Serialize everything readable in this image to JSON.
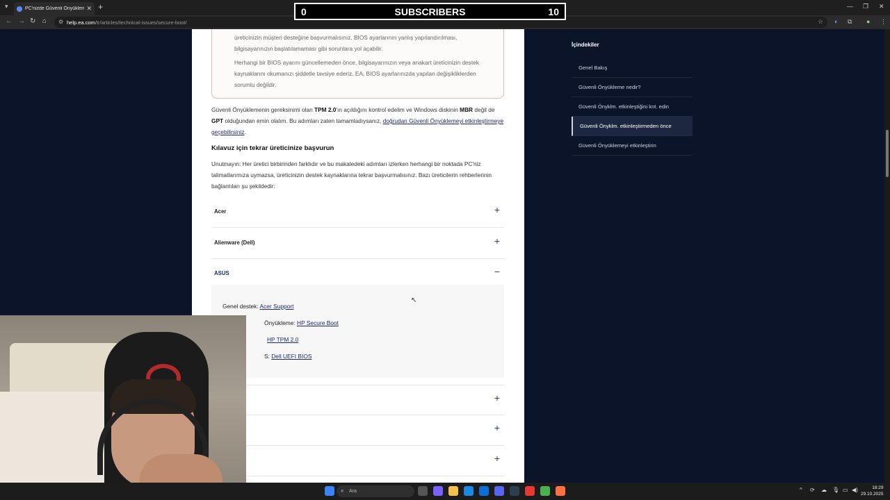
{
  "browser": {
    "tab_title": "PC'nizde Güvenli Önyükleme n...",
    "url_domain": "help.ea.com",
    "url_path": "/tr/articles/technical-issues/secure-boot/"
  },
  "overlay": {
    "subs_left": "0",
    "subs_label": "SUBSCRIBERS",
    "subs_right": "10"
  },
  "article": {
    "warn_p1": "üreticinizin müşteri desteğine başvurmalısınız. BIOS ayarlarının yanlış yapılandırılması, bilgisayarınızın başlatılamaması gibi sorunlara yol açabilir.",
    "warn_p2": "Herhangi bir BIOS ayarını güncellemeden önce, bilgisayarınızın veya anakart üreticinizin destek kaynaklarını okumanızı şiddetle tavsiye ederiz. EA, BIOS ayarlarınızda yapılan değişikliklerden sorumlu değildir.",
    "intro_a": "Güvenli Önyüklemenin gereksinimi olan ",
    "intro_tpm": "TPM 2.0",
    "intro_b": "'ın açıldığını kontrol edelim ve Windows diskinin ",
    "intro_mbr": "MBR",
    "intro_c": " değil de ",
    "intro_gpt": "GPT",
    "intro_d": " olduğundan emin olalım. Bu adımları zaten tamamladıysanız, ",
    "intro_link": "doğrudan Güvenli Önyüklemeyi etkinleştirmeye geçebilirsiniz",
    "intro_e": ".",
    "heading": "Kılavuz için tekrar üreticinize başvurun",
    "note": "Unutmayın: Her üretici birbirinden farklıdır ve bu makaledeki adımları izlerken herhangi bir noktada PC'niz talimatlarımıza uymazsa, üreticinizin destek kaynaklarına tekrar başvurmalısınız. Bazı üreticilerin rehberlerinin bağlantıları şu şekildedir:",
    "accordions": [
      {
        "label": "Acer",
        "sign": "+"
      },
      {
        "label": "Alienware (Dell)",
        "sign": "+"
      },
      {
        "label": "ASUS",
        "sign": "−"
      }
    ],
    "asus_rows": [
      {
        "prefix": "Genel destek: ",
        "link": "Acer Support"
      },
      {
        "prefix": "Önyükleme: ",
        "link": "HP Secure Boot"
      },
      {
        "prefix": "",
        "link": "HP TPM 2.0"
      },
      {
        "prefix": "S: ",
        "link": "Dell UEFI BIOS"
      }
    ],
    "more_signs": [
      "+",
      "+",
      "+"
    ]
  },
  "toc": {
    "title": "İçindekiler",
    "items": [
      "Genel Bakış",
      "Güvenli Önyükleme nedir?",
      "Güvenli Önyklm. etkinleştiğini knt. edin",
      "Güvenli Önyklm. etkinleştirmeden önce",
      "Güvenli Önyüklemeyi etkinleştirin"
    ],
    "active_index": 3
  },
  "taskbar": {
    "search_placeholder": "Ara",
    "time": "18:29",
    "date": "29.10.2025"
  }
}
